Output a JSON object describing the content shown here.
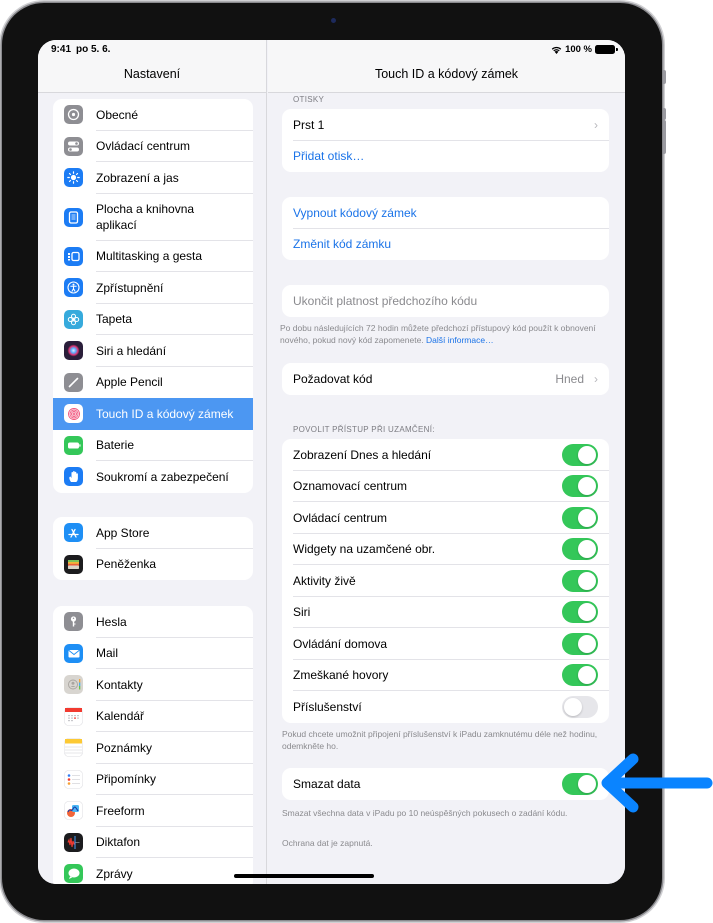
{
  "status_bar": {
    "time": "9:41",
    "date": "po 5. 6.",
    "battery": "100 %"
  },
  "sidebar": {
    "title": "Nastavení",
    "groups": [
      [
        {
          "label": "Obecné",
          "icon": "gear-icon",
          "color": "#8e8e93"
        },
        {
          "label": "Ovládací centrum",
          "icon": "switches-icon",
          "color": "#8e8e93"
        },
        {
          "label": "Zobrazení a jas",
          "icon": "sun-icon",
          "color": "#1c7cf4"
        },
        {
          "label": "Plocha a knihovna aplikací",
          "icon": "home-screen-icon",
          "color": "#1c7cf4"
        },
        {
          "label": "Multitasking a gesta",
          "icon": "multitasking-icon",
          "color": "#1c7cf4"
        },
        {
          "label": "Zpřístupnění",
          "icon": "accessibility-icon",
          "color": "#1c7cf4"
        },
        {
          "label": "Tapeta",
          "icon": "flower-icon",
          "color": "#36aadc"
        },
        {
          "label": "Siri a hledání",
          "icon": "siri-icon",
          "color": "#2a1e3a"
        },
        {
          "label": "Apple Pencil",
          "icon": "pencil-icon",
          "color": "#8e8e93"
        },
        {
          "label": "Touch ID a kódový zámek",
          "icon": "fingerprint-icon",
          "color": "#ffffff",
          "selected": true
        },
        {
          "label": "Baterie",
          "icon": "battery-icon",
          "color": "#34c759"
        },
        {
          "label": "Soukromí a zabezpečení",
          "icon": "hand-icon",
          "color": "#1c7cf4"
        }
      ],
      [
        {
          "label": "App Store",
          "icon": "app-store-icon",
          "color": "#1e8ff5"
        },
        {
          "label": "Peněženka",
          "icon": "wallet-icon",
          "color": "#1c1c1e"
        }
      ],
      [
        {
          "label": "Hesla",
          "icon": "key-icon",
          "color": "#8e8e93"
        },
        {
          "label": "Mail",
          "icon": "mail-icon",
          "color": "#1e8ff5"
        },
        {
          "label": "Kontakty",
          "icon": "contacts-icon",
          "color": "#d8d5d0"
        },
        {
          "label": "Kalendář",
          "icon": "calendar-icon",
          "color": "#ffffff"
        },
        {
          "label": "Poznámky",
          "icon": "notes-icon",
          "color": "#ffffff"
        },
        {
          "label": "Připomínky",
          "icon": "reminders-icon",
          "color": "#ffffff"
        },
        {
          "label": "Freeform",
          "icon": "freeform-icon",
          "color": "#ffffff"
        },
        {
          "label": "Diktafon",
          "icon": "voice-memos-icon",
          "color": "#1c1c1e"
        },
        {
          "label": "Zprávy",
          "icon": "messages-icon",
          "color": "#34c759"
        }
      ]
    ]
  },
  "detail": {
    "title": "Touch ID a kódový zámek",
    "fingerprints_label": "OTISKY",
    "finger1": "Prst 1",
    "add_fingerprint": "Přidat otisk…",
    "turn_off_passcode": "Vypnout kódový zámek",
    "change_passcode": "Změnit kód zámku",
    "expire_previous": "Ukončit platnost předchozího kódu",
    "expire_note": "Po dobu následujících 72 hodin můžete předchozí přístupový kód použít k obnovení nového, pokud nový kód zapomenete.",
    "expire_link": "Další informace…",
    "require_passcode": "Požadovat kód",
    "require_passcode_value": "Hned",
    "allow_access_label": "POVOLIT PŘÍSTUP PŘI UZAMČENÍ:",
    "toggles": [
      {
        "label": "Zobrazení Dnes a hledání",
        "on": true
      },
      {
        "label": "Oznamovací centrum",
        "on": true
      },
      {
        "label": "Ovládací centrum",
        "on": true
      },
      {
        "label": "Widgety na uzamčené obr.",
        "on": true
      },
      {
        "label": "Aktivity živě",
        "on": true
      },
      {
        "label": "Siri",
        "on": true
      },
      {
        "label": "Ovládání domova",
        "on": true
      },
      {
        "label": "Zmeškané hovory",
        "on": true
      },
      {
        "label": "Příslušenství",
        "on": false
      }
    ],
    "accessories_note": "Pokud chcete umožnit připojení příslušenství k iPadu zamknutému déle než hodinu, odemkněte ho.",
    "erase_data": "Smazat data",
    "erase_data_on": true,
    "erase_note": "Smazat všechna data v iPadu po 10 neúspěšných pokusech o zadání kódu.",
    "protection_note": "Ochrana dat je zapnutá."
  },
  "colors": {
    "accent": "#1a73e8",
    "toggle_on": "#34c759",
    "selection": "#4c97f2",
    "callout_arrow": "#0a84ff"
  }
}
